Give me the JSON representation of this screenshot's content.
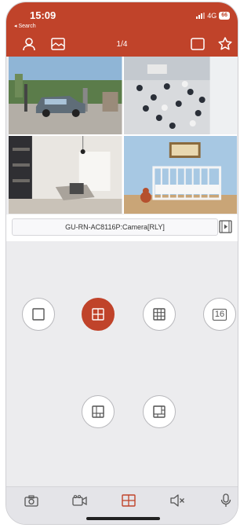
{
  "status": {
    "time": "15:09",
    "back_label": "◂ Search",
    "network": "4G",
    "battery": "66"
  },
  "header": {
    "page_indicator": "1/4"
  },
  "camera": {
    "name": "GU-RN-AC8116P:Camera[RLY]"
  },
  "layouts": [
    {
      "name": "single-layout",
      "label": "",
      "selected": false
    },
    {
      "name": "quad-layout",
      "label": "",
      "selected": true
    },
    {
      "name": "nine-layout",
      "label": "",
      "selected": false
    },
    {
      "name": "sixteen-layout",
      "label": "16",
      "selected": false
    },
    {
      "name": "custom-layout-a",
      "label": "",
      "selected": false
    },
    {
      "name": "custom-layout-b",
      "label": "",
      "selected": false
    }
  ],
  "colors": {
    "accent": "#c0432a",
    "panel": "#ececee",
    "icon": "#555555"
  },
  "icons": [
    "person-icon",
    "image-icon",
    "fullscreen-icon",
    "star-icon",
    "playback-icon",
    "camera-icon",
    "record-icon",
    "grid-icon",
    "mute-icon",
    "microphone-icon"
  ]
}
